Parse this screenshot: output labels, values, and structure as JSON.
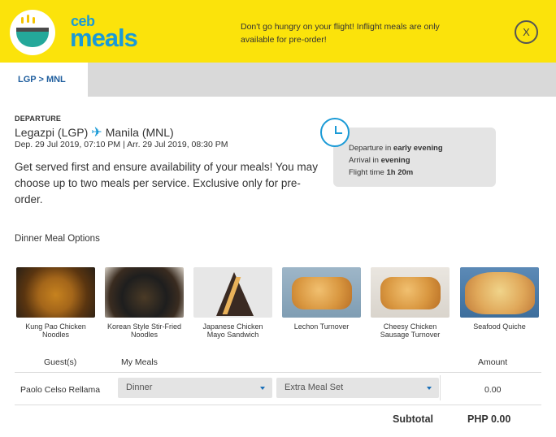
{
  "header": {
    "logo_small": "ceb",
    "logo_big": "meals",
    "promo": "Don't go hungry on your flight! Inflight meals are only available for pre-order!",
    "close_label": "X",
    "background_color": "#fbe30b",
    "brand_color": "#1a9ad6"
  },
  "tabs": [
    {
      "label": "LGP > MNL",
      "active": true
    }
  ],
  "flight": {
    "direction_label": "DEPARTURE",
    "origin": "Legazpi (LGP)",
    "destination": "Manila (MNL)",
    "dates": "Dep. 29 Jul 2019, 07:10 PM | Arr. 29 Jul 2019, 08:30 PM",
    "intro": "Get served first and ensure availability of your meals! You may choose up to two meals per service. Exclusive only for pre-order.",
    "departure_prefix": "Departure in",
    "departure_value": "early evening",
    "arrival_prefix": "Arrival in",
    "arrival_value": "evening",
    "flight_time_prefix": "Flight time",
    "flight_time_value": "1h 20m"
  },
  "meals": {
    "section_title": "Dinner Meal Options",
    "items": [
      {
        "name": "Kung Pao Chicken Noodles",
        "icon": "noodles-photo"
      },
      {
        "name": "Korean Style Stir-Fried Noodles",
        "icon": "noodles-photo"
      },
      {
        "name": "Japanese Chicken Mayo Sandwich",
        "icon": "sandwich-photo"
      },
      {
        "name": "Lechon Turnover",
        "icon": "pastry-photo"
      },
      {
        "name": "Cheesy Chicken Sausage Turnover",
        "icon": "pastry-photo"
      },
      {
        "name": "Seafood Quiche",
        "icon": "quiche-photo"
      }
    ]
  },
  "table": {
    "headers": {
      "guest": "Guest(s)",
      "meals": "My Meals",
      "amount": "Amount"
    },
    "rows": [
      {
        "guest": "Paolo Celso Rellama",
        "meal_select": "Dinner",
        "set_select": "Extra Meal Set",
        "amount": "0.00"
      }
    ],
    "subtotal_label": "Subtotal",
    "subtotal_value": "PHP 0.00"
  }
}
